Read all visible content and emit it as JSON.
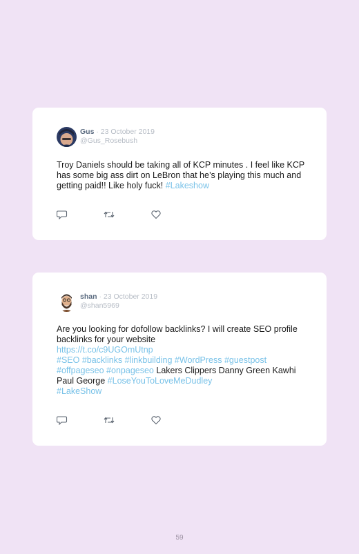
{
  "tweets": [
    {
      "name": "Gus",
      "date": "· 23 October 2019",
      "handle": "@Gus_Rosebush",
      "text_plain": "Troy Daniels should be taking all of KCP minutes . I feel like KCP has some big ass dirt on LeBron that he’s playing this much and getting paid!! Like holy fuck! ",
      "hashtag": "#Lakeshow"
    },
    {
      "name": "shan",
      "date": "· 23 October 2019",
      "handle": "@shan5969",
      "text_plain": "Are you looking for dofollow backlinks? I will create SEO profile backlinks for your website",
      "url": "https://t.co/c9UGOmUtnp",
      "tags_line1": "#SEO #backlinks #linkbuilding #WordPress #guestpost",
      "tags_line2": "#offpageseo #onpageseo",
      "plain_after": " Lakers Clippers Danny Green Kawhi Paul George ",
      "tag_lose": "#LoseYouToLoveMeDudley",
      "tag_lake": "#LakeShow"
    }
  ],
  "icons": [
    "reply-icon",
    "retweet-icon",
    "like-icon"
  ],
  "page_number": "59"
}
